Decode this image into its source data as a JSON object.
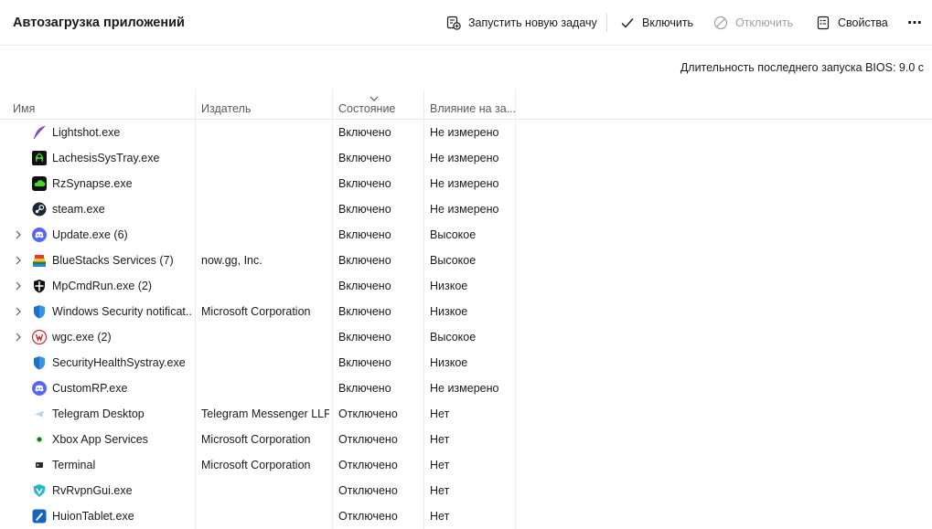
{
  "header": {
    "title": "Автозагрузка приложений",
    "run_task": "Запустить новую задачу",
    "enable": "Включить",
    "disable": "Отключить",
    "properties": "Свойства",
    "more": "⋯"
  },
  "bios_time": "Длительность последнего запуска BIOS: 9.0 с",
  "columns": {
    "name": "Имя",
    "publisher": "Издатель",
    "status": "Состояние",
    "impact": "Влияние на за..."
  },
  "rows": [
    {
      "name": "Lightshot.exe",
      "publisher": "",
      "status": "Включено",
      "impact": "Не измерено",
      "expandable": false,
      "icon": "lightshot-feather-icon"
    },
    {
      "name": "LachesisSysTray.exe",
      "publisher": "",
      "status": "Включено",
      "impact": "Не измерено",
      "expandable": false,
      "icon": "razer-icon"
    },
    {
      "name": "RzSynapse.exe",
      "publisher": "",
      "status": "Включено",
      "impact": "Не измерено",
      "expandable": false,
      "icon": "synapse-cloud-icon"
    },
    {
      "name": "steam.exe",
      "publisher": "",
      "status": "Включено",
      "impact": "Не измерено",
      "expandable": false,
      "icon": "steam-icon"
    },
    {
      "name": "Update.exe (6)",
      "publisher": "",
      "status": "Включено",
      "impact": "Высокое",
      "expandable": true,
      "icon": "discord-icon"
    },
    {
      "name": "BlueStacks Services (7)",
      "publisher": "now.gg, Inc.",
      "status": "Включено",
      "impact": "Высокое",
      "expandable": true,
      "icon": "bluestacks-icon"
    },
    {
      "name": "MpCmdRun.exe (2)",
      "publisher": "",
      "status": "Включено",
      "impact": "Низкое",
      "expandable": true,
      "icon": "defender-icon"
    },
    {
      "name": "Windows Security notificat...",
      "publisher": "Microsoft Corporation",
      "status": "Включено",
      "impact": "Низкое",
      "expandable": true,
      "icon": "windows-security-shield-icon"
    },
    {
      "name": "wgc.exe (2)",
      "publisher": "",
      "status": "Включено",
      "impact": "Высокое",
      "expandable": true,
      "icon": "wargaming-icon"
    },
    {
      "name": "SecurityHealthSystray.exe",
      "publisher": "",
      "status": "Включено",
      "impact": "Низкое",
      "expandable": false,
      "icon": "windows-security-shield-icon"
    },
    {
      "name": "CustomRP.exe",
      "publisher": "",
      "status": "Включено",
      "impact": "Не измерено",
      "expandable": false,
      "icon": "discord-icon"
    },
    {
      "name": "Telegram Desktop",
      "publisher": "Telegram Messenger LLP",
      "status": "Отключено",
      "impact": "Нет",
      "expandable": false,
      "icon": "telegram-icon"
    },
    {
      "name": "Xbox App Services",
      "publisher": "Microsoft Corporation",
      "status": "Отключено",
      "impact": "Нет",
      "expandable": false,
      "icon": "xbox-icon"
    },
    {
      "name": "Terminal",
      "publisher": "Microsoft Corporation",
      "status": "Отключено",
      "impact": "Нет",
      "expandable": false,
      "icon": "terminal-icon"
    },
    {
      "name": "RvRvpnGui.exe",
      "publisher": "",
      "status": "Отключено",
      "impact": "Нет",
      "expandable": false,
      "icon": "vpn-shield-icon"
    },
    {
      "name": "HuionTablet.exe",
      "publisher": "",
      "status": "Отключено",
      "impact": "Нет",
      "expandable": false,
      "icon": "huion-pen-icon"
    }
  ],
  "colors": {
    "accent": "#005fb8",
    "discord": "#5865f2",
    "razer_green": "#44d62c",
    "security_blue": "#1a73c8"
  }
}
